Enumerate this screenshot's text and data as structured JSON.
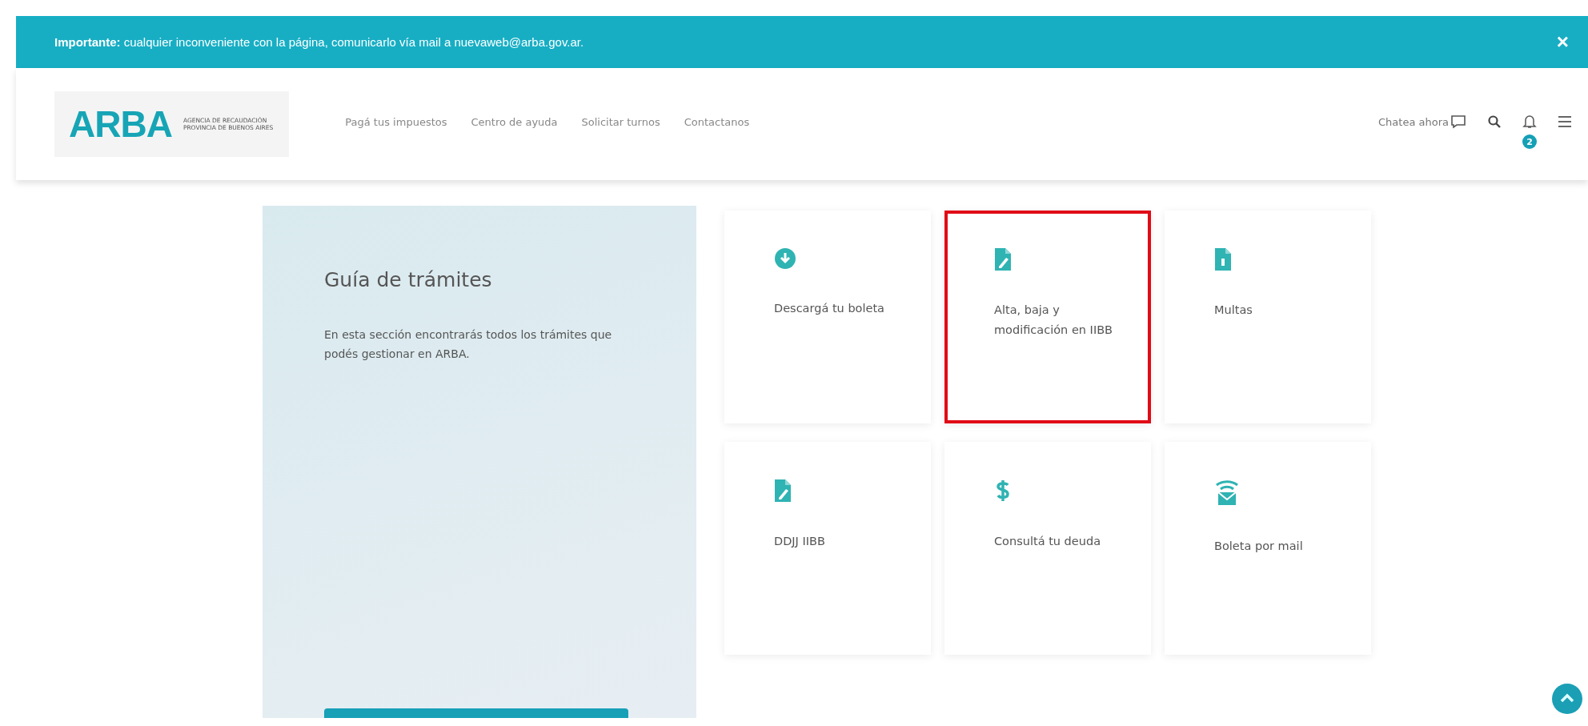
{
  "banner": {
    "text": "**Importante:** cualquier inconveniente con la página, comunicarlo vía mail a nuevaweb@arba.gov.ar.",
    "close": "×"
  },
  "header": {
    "logo": "ARBA",
    "logo_subtitle": [
      "AGENCIA DE RECAUDACIÓN",
      "PROVINCIA DE BUENOS AIRES"
    ],
    "nav": [
      "Pagá tus impuestos",
      "Centro de ayuda",
      "Solicitar turnos",
      "Contactanos"
    ],
    "chat": "Chatea ahora",
    "notifications": "2"
  },
  "guide": {
    "title": "Guía de trámites",
    "description": "En esta sección encontrarás todos los trámites que podés gestionar en ARBA."
  },
  "tiles": [
    {
      "kind": "download",
      "label": "Descargá tu boleta",
      "highlighted": false
    },
    {
      "kind": "edit",
      "label": "Alta, baja y modificación en IIBB",
      "highlighted": true
    },
    {
      "kind": "document",
      "label": "Multas",
      "highlighted": false
    },
    {
      "kind": "edit",
      "label": "DDJJ IIBB",
      "highlighted": false
    },
    {
      "kind": "dollar",
      "label": "Consultá tu deuda",
      "highlighted": false
    },
    {
      "kind": "mail",
      "label": "Boleta por mail",
      "highlighted": false
    }
  ]
}
